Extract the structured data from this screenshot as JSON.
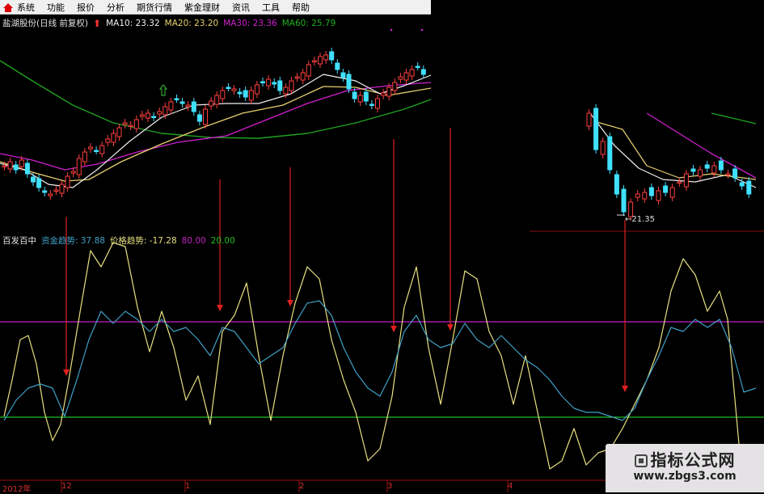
{
  "menu": {
    "items": [
      "系统",
      "功能",
      "报价",
      "分析",
      "期货行情",
      "紫金理财",
      "资讯",
      "工具",
      "帮助"
    ]
  },
  "price_panel": {
    "title": "盐湖股份(日线 前复权)",
    "ma10": "MA10: 23.32",
    "ma20": "MA20: 23.20",
    "ma30": "MA30: 23.36",
    "ma60": "MA60: 25.79",
    "low_label": "21.35"
  },
  "indicator_panel": {
    "name": "百发百中",
    "fund_trend": "资金趋势: 37.88",
    "price_trend": "价格趋势: -17.28",
    "level_high": "80.00",
    "level_low": "20.00"
  },
  "date_axis": {
    "labels": [
      "2012年",
      "12",
      "1",
      "2",
      "3",
      "4"
    ]
  },
  "watermark": {
    "line1": "指标公式网",
    "line2": "www.zbgs3.com"
  },
  "colors": {
    "background": "#000000",
    "up_candle": "#ff4040",
    "down_candle": "#40e0ff",
    "ma10": "#f0f0f0",
    "ma20": "#e8d070",
    "ma30": "#d020d0",
    "ma60": "#20a020",
    "fund_trend": "#40a0c8",
    "price_trend": "#e8e080",
    "level_80": "#c020c0",
    "level_20": "#20c020",
    "signal_arrow": "#e02020"
  },
  "chart_data": {
    "type": "line",
    "title": "盐湖股份(日线 前复权)",
    "x_axis_labels": [
      "2012年",
      "12",
      "1",
      "2",
      "3",
      "4"
    ],
    "price_legend": [
      {
        "name": "MA10",
        "value": 23.32
      },
      {
        "name": "MA20",
        "value": 23.2
      },
      {
        "name": "MA30",
        "value": 23.36
      },
      {
        "name": "MA60",
        "value": 25.79
      }
    ],
    "price_annotation": {
      "label": "21.35",
      "value": 21.35
    },
    "indicator": {
      "name": "百发百中",
      "series": [
        {
          "name": "资金趋势",
          "last": 37.88
        },
        {
          "name": "价格趋势",
          "last": -17.28
        }
      ],
      "levels": [
        80.0,
        20.0
      ]
    }
  }
}
